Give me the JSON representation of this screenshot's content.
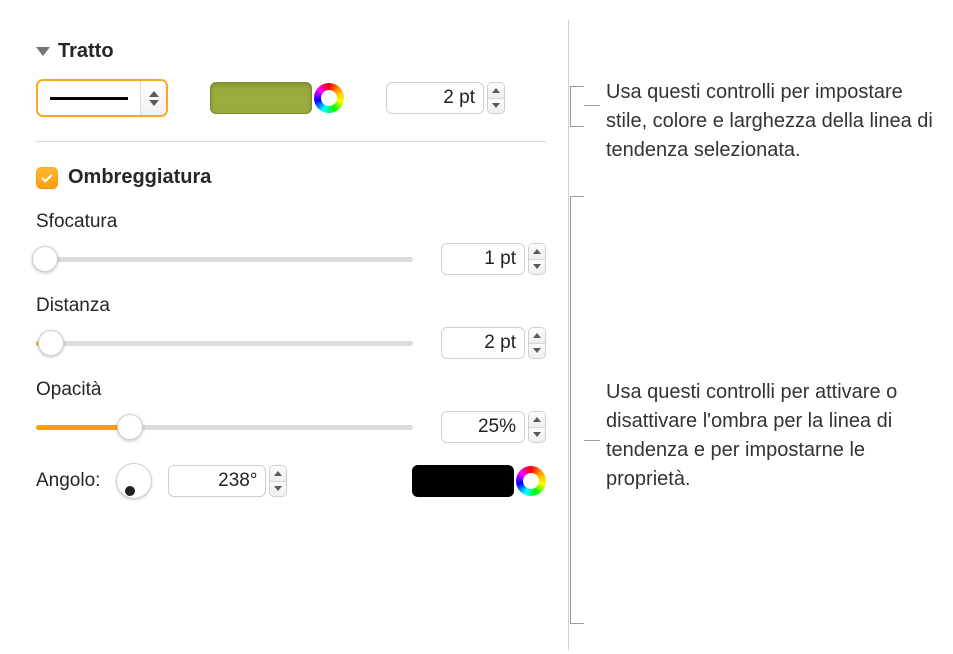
{
  "stroke": {
    "section_title": "Tratto",
    "color": "#9aac3e",
    "width_value": "2 pt"
  },
  "shadow": {
    "checkbox_label": "Ombreggiatura",
    "checked": true,
    "blur": {
      "label": "Sfocatura",
      "value": "1 pt",
      "percent": 2
    },
    "offset": {
      "label": "Distanza",
      "value": "2 pt",
      "percent": 4
    },
    "opacity": {
      "label": "Opacità",
      "value": "25%",
      "percent": 25
    },
    "angle": {
      "label": "Angolo:",
      "value": "238°",
      "degrees": 238
    },
    "shadow_color": "#000000"
  },
  "callouts": {
    "top": "Usa questi controlli per impostare stile, colore e larghezza della linea di tendenza selezionata.",
    "bottom": "Usa questi controlli per attivare o disattivare l'ombra per la linea di tendenza e per impostarne le proprietà."
  }
}
